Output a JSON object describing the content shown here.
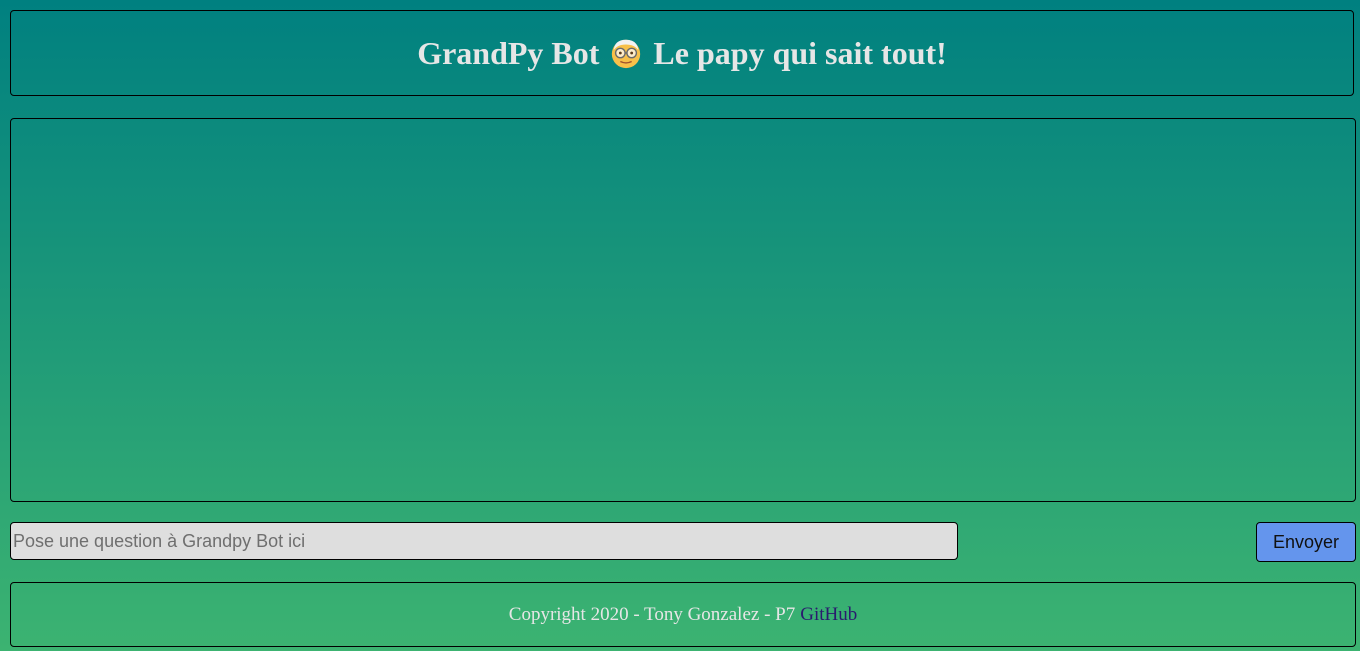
{
  "header": {
    "title_part1": "GrandPy Bot",
    "title_part2": "Le papy qui sait tout!",
    "emoji_icon": "old-man-face-icon"
  },
  "chat": {
    "messages": []
  },
  "form": {
    "question_placeholder": "Pose une question à Grandpy Bot ici",
    "question_value": "",
    "send_label": "Envoyer"
  },
  "footer": {
    "copyright_text": "Copyright 2020 - Tony Gonzalez - P7",
    "github_label": "GitHub"
  },
  "colors": {
    "gradient_top": "#008080",
    "gradient_bottom": "#3cb371",
    "send_button": "#6495ed",
    "input_background": "#dedede",
    "title_text": "#e6e6e6",
    "link": "#2a1a6e"
  }
}
